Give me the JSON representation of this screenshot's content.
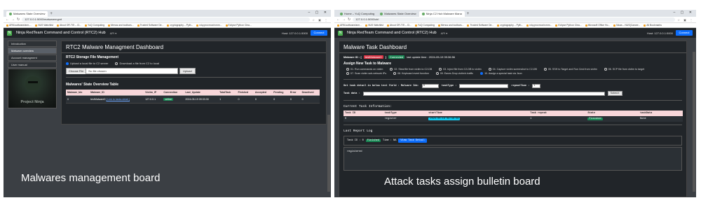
{
  "left": {
    "tabs": [
      {
        "label": "Malwares State Overview",
        "active": true
      }
    ],
    "url": "127.0.0.1:5000/malwaremgmt",
    "bookmarks": [
      "ARM-software/arm-...",
      "NUS Watchlist",
      "About OR-TIS – Cl...",
      "YuQ Computing",
      "Menus and toolbars...",
      "Trusted Software De...",
      "cryptography – Pyth...",
      "rcky.proxmox/rcmm...",
      "Eclipse Python Clea..."
    ],
    "app": {
      "title": "Ninja RedTeam Command and Control (RTC2) Hub",
      "api_menu": "API",
      "host": "Host: 127.0.0.1:5000",
      "connect": "Connect"
    },
    "sidebar": [
      "Introduction",
      "Malware overview",
      "Account managment",
      "User manual"
    ],
    "sidebar_active": 1,
    "image_title": "Project Ninja",
    "dashboard_title": "RTC2 Malware Managment Dashboard",
    "storage": {
      "title": "RTC2 Storage File Management",
      "opt_upload": "Upload a local file to C2 server",
      "opt_download": "Download a file from C2 to local",
      "choose": "Choose File",
      "nofile": "No file chosen",
      "upload": "Upload"
    },
    "overview": {
      "title": "Malwares' State Overview Table",
      "headers": [
        "Malware_Idx",
        "Malware_ID",
        "Victim_IP",
        "Connection",
        "Last_Update",
        "TotalTask",
        "Finished",
        "Accepted",
        "Pending",
        "Error",
        "Deactived"
      ],
      "row": {
        "idx": "0",
        "id": "testMalware0",
        "link": "[ Link to tasks detail ]",
        "ip": "127.0.0.1",
        "conn": "online",
        "update": "2024-05-19 09:33:30",
        "total": "1",
        "finished": "0",
        "accepted": "0",
        "pending": "0",
        "error": "0",
        "deactived": "0"
      }
    },
    "caption": "Malwares management board"
  },
  "right": {
    "tabs": [
      {
        "label": "Home – YuQ Computing",
        "active": false
      },
      {
        "label": "Malwares State Overview",
        "active": false
      },
      {
        "label": "Ninja C2 Hub Malware Mana",
        "active": true
      }
    ],
    "url": "127.0.0.1:5000/ctrl",
    "bookmarks": [
      "ARM-software/arm...",
      "NUS Watchlist",
      "About OR-TIS – Cl...",
      "YuQ Computing",
      "Menus and toolbars...",
      "Trusted Software De...",
      "cryptography – Pyth...",
      "rcky.proxmox/rcmm...",
      "Eclipse Python Clea...",
      "Microsoft Office Ho...",
      "Nicas – NUS(Cancer...",
      "All Bookmarks"
    ],
    "app": {
      "title": "Ninja RedTeam Command and Control (RTC2) Hub",
      "api_menu": "API",
      "host": "Host: 127.0.0.1:5000",
      "connect": "Connect"
    },
    "dashboard_title": "Malware Task Dashboard",
    "malware": {
      "label": "Malware ID : [",
      "id": "testMalware0",
      "close": "]",
      "status": "Connected",
      "last_update": "last update time : 2024-05-19 09:36:56"
    },
    "assign_title": "Assign New Task to Malware",
    "tasks": [
      "01. Run commands on victim",
      "02. Steal file from victim to C2-DB",
      "03. Inject file from C2-DB to victim",
      "04. Capture victim screenshot to C2-DB",
      "05. SSH to Target and Run Cmd from victim",
      "06. SCP file from victim to target",
      "07. Scan victim sub-network IPs",
      "08. Keyboard event function",
      "09. Eaves Drop victim's traffic",
      "10. Assign a special task via Json"
    ],
    "selected_task": 9,
    "detail": {
      "label": "Set task detail in below text field : Malware Idx:",
      "idx": "0",
      "tasktype": "taskType :",
      "repeat": "repeatTime :",
      "repeat_val": "1"
    },
    "taskdata": {
      "label": "Task data :",
      "submit": "Submit"
    },
    "current_title": "Current Task Information:",
    "current": {
      "headers": [
        "Task ID",
        "taskType",
        "startTime",
        "Task repeat",
        "State",
        "taskData"
      ],
      "row": {
        "id": "0",
        "type": "register",
        "start": "2024-05-19 09:36:56",
        "repeat": "1",
        "state": "Finished",
        "data": "None"
      }
    },
    "report_title": "Last Report Log",
    "report": {
      "task_id": "Task ID : 0",
      "state": "Finished",
      "time": "Time : NA",
      "view": "View Task Detail"
    },
    "log_text": "registered",
    "caption": "Attack tasks assign  bulletin board"
  }
}
